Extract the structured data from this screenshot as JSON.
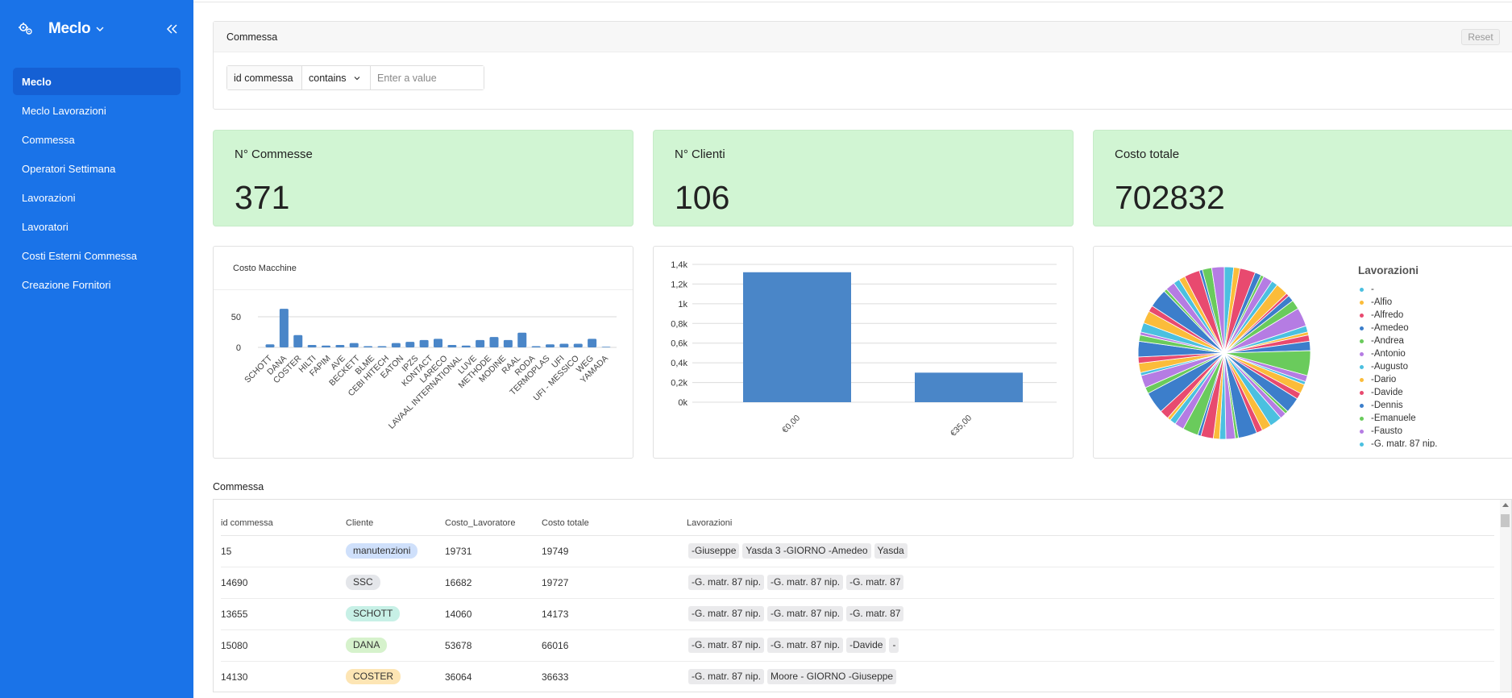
{
  "sidebar": {
    "title": "Meclo",
    "items": [
      {
        "label": "Meclo"
      },
      {
        "label": "Meclo Lavorazioni"
      },
      {
        "label": "Commessa"
      },
      {
        "label": "Operatori Settimana"
      },
      {
        "label": "Lavorazioni"
      },
      {
        "label": "Lavoratori"
      },
      {
        "label": "Costi Esterni Commessa"
      },
      {
        "label": "Creazione Fornitori"
      }
    ],
    "active_index": 0,
    "bg_color": "#1a73e8"
  },
  "filter": {
    "title": "Commessa",
    "reset_label": "Reset",
    "field": "id commessa",
    "operator": "contains",
    "placeholder": "Enter a value"
  },
  "metrics": [
    {
      "label": "N° Commesse",
      "value": "371"
    },
    {
      "label": "N° Clienti",
      "value": "106"
    },
    {
      "label": "Costo totale",
      "value": "702832"
    }
  ],
  "chart_data": [
    {
      "type": "bar",
      "title": "Costo Macchine",
      "xlabel": "",
      "ylabel": "",
      "categories": [
        "SCHOTT",
        "",
        "DANA",
        "",
        "COSTER",
        "",
        "HILTI",
        "",
        "FAPIM",
        "",
        "AVE",
        "",
        "BECKETT",
        "",
        "BLME",
        "",
        "CEBI HITECH",
        "",
        "EATON",
        "",
        "IPZS",
        "",
        "KONTACT",
        "",
        "LARECO",
        "",
        "LAVAAL INTERNATIONAL",
        "",
        "LUVE",
        "",
        "METHODE",
        "",
        "MODINE",
        "",
        "RAAL",
        "",
        "RODA",
        "",
        "TERMOPLAS",
        "",
        "UFI",
        "",
        "UFI - MESSICO",
        "",
        "WEG",
        "",
        "YAMADA"
      ],
      "values": [
        5,
        63,
        20,
        4,
        3,
        4,
        7,
        2,
        2,
        7,
        9,
        12,
        14,
        4,
        3,
        12,
        17,
        12,
        24,
        2,
        5,
        6,
        6,
        14,
        1
      ],
      "yticks": [
        "50",
        "0"
      ],
      "ylim": [
        0,
        75
      ],
      "color": "#4a86c8"
    },
    {
      "type": "bar",
      "categories": [
        "€0,00",
        "€35,00"
      ],
      "values": [
        1320,
        300
      ],
      "yticks": [
        "1,4k",
        "1,2k",
        "1k",
        "0,8k",
        "0,6k",
        "0,4k",
        "0,2k",
        "0k"
      ],
      "ylim": [
        0,
        1400
      ],
      "color": "#4a86c8"
    },
    {
      "type": "pie",
      "legend_title": "Lavorazioni",
      "legend": [
        "-",
        "-Alfio",
        "-Alfredo",
        "-Amedeo",
        "-Andrea",
        "-Antonio",
        "-Augusto",
        "-Dario",
        "-Davide",
        "-Dennis",
        "-Emanuele",
        "-Fausto",
        "-G. matr. 87 nip."
      ],
      "palette": [
        "#4bc0e0",
        "#fbbc3a",
        "#e84a6f",
        "#3c7ecb",
        "#6acb5c",
        "#b57ce3"
      ],
      "slices": [
        3,
        2,
        5,
        2,
        1,
        3,
        2,
        4,
        1,
        2,
        3,
        6,
        2,
        1,
        2,
        3,
        8,
        2,
        1,
        3,
        2,
        5,
        1,
        2,
        4,
        3,
        2,
        6,
        1,
        3,
        2,
        2,
        4,
        1,
        5,
        3,
        2,
        1,
        3,
        7,
        2,
        4,
        1,
        3,
        2,
        5,
        2,
        1,
        3,
        4,
        2,
        6,
        1,
        3,
        2,
        2,
        5,
        1,
        3,
        4
      ]
    }
  ],
  "table": {
    "title": "Commessa",
    "headers": [
      "id commessa",
      "Cliente",
      "Costo_Lavoratore",
      "Costo totale",
      "Lavorazioni"
    ],
    "rows": [
      {
        "id": "15",
        "cliente": "manutenzioni",
        "cliente_color": "#cfe0fb",
        "costo_lav": "19731",
        "costo_tot": "19749",
        "lavorazioni": [
          "-Giuseppe",
          "Yasda 3 -GIORNO -Amedeo",
          "Yasda"
        ]
      },
      {
        "id": "14690",
        "cliente": "SSC",
        "cliente_color": "#e4e6ea",
        "costo_lav": "16682",
        "costo_tot": "19727",
        "lavorazioni": [
          "-G. matr. 87 nip.",
          "-G. matr. 87 nip.",
          "-G. matr. 87"
        ]
      },
      {
        "id": "13655",
        "cliente": "SCHOTT",
        "cliente_color": "#c7f0e6",
        "costo_lav": "14060",
        "costo_tot": "14173",
        "lavorazioni": [
          "-G. matr. 87 nip.",
          "-G. matr. 87 nip.",
          "-G. matr. 87"
        ]
      },
      {
        "id": "15080",
        "cliente": "DANA",
        "cliente_color": "#d6f2cc",
        "costo_lav": "53678",
        "costo_tot": "66016",
        "lavorazioni": [
          "-G. matr. 87 nip.",
          "-G. matr. 87 nip.",
          "-Davide",
          "-"
        ]
      },
      {
        "id": "14130",
        "cliente": "COSTER",
        "cliente_color": "#fde5b4",
        "costo_lav": "36064",
        "costo_tot": "36633",
        "lavorazioni": [
          "-G. matr. 87 nip.",
          "Moore - GIORNO -Giuseppe"
        ]
      }
    ]
  }
}
